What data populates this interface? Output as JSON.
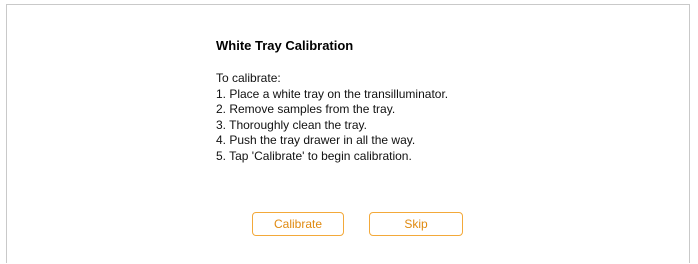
{
  "dialog": {
    "title": "White Tray Calibration",
    "intro": "To calibrate:",
    "steps": [
      "1. Place a white tray on the transilluminator.",
      "2. Remove samples from the tray.",
      "3. Thoroughly clean the tray.",
      "4. Push the tray drawer in all the way.",
      "5. Tap 'Calibrate' to begin calibration."
    ]
  },
  "buttons": {
    "calibrate_label": "Calibrate",
    "skip_label": "Skip"
  },
  "colors": {
    "accent": "#f3a93a",
    "accent_text": "#e08a10",
    "border": "#c9c9c9"
  }
}
